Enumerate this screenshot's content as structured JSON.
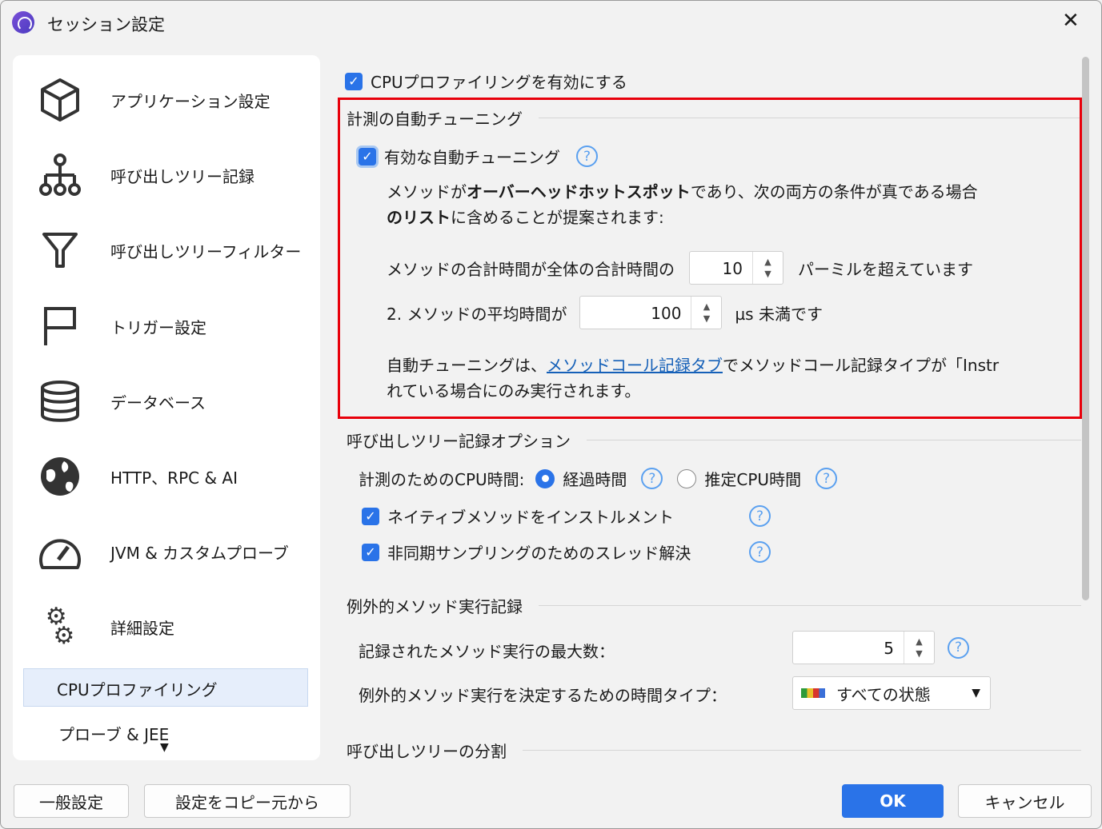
{
  "window": {
    "title": "セッション設定",
    "close": "✕"
  },
  "sidebar": {
    "items": [
      {
        "label": "アプリケーション設定",
        "icon": "cube-icon"
      },
      {
        "label": "呼び出しツリー記録",
        "icon": "tree-icon"
      },
      {
        "label": "呼び出しツリーフィルター",
        "icon": "filter-icon"
      },
      {
        "label": "トリガー設定",
        "icon": "flag-icon"
      },
      {
        "label": "データベース",
        "icon": "database-icon"
      },
      {
        "label": "HTTP、RPC & AI",
        "icon": "globe-icon"
      },
      {
        "label": "JVM & カスタムプローブ",
        "icon": "gauge-icon"
      },
      {
        "label": "詳細設定",
        "icon": "gears-icon"
      }
    ],
    "subitems": [
      "CPUプロファイリング",
      "プローブ & JEE"
    ]
  },
  "main": {
    "enable_cpu": "CPUプロファイリングを有効にする",
    "autotune_section": "計測の自動チューニング",
    "autotune_enable": "有効な自動チューニング",
    "desc1_a": "メソッドが",
    "desc1_b": "オーバーヘッドホットスポット",
    "desc1_c": "であり、次の両方の条件が真である場合",
    "desc2_a": "のリスト",
    "desc2_b": "に含めることが提案されます:",
    "cond1_label": "メソッドの合計時間が全体の合計時間の",
    "cond1_value": "10",
    "cond1_suffix": "パーミルを超えています",
    "cond2_label": "2. メソッドの平均時間が",
    "cond2_value": "100",
    "cond2_suffix": "µs 未満です",
    "note_a": "自動チューニングは、",
    "note_link": "メソッドコール記録タブ",
    "note_b": "でメソッドコール記録タイプが「Instr",
    "note2": "れている場合にのみ実行されます。",
    "calltree_section": "呼び出しツリー記録オプション",
    "cpu_time_label": "計測のためのCPU時間:",
    "radio_elapsed": "経過時間",
    "radio_cpu": "推定CPU時間",
    "native_label": "ネイティブメソッドをインストルメント",
    "async_label": "非同期サンプリングのためのスレッド解決",
    "exceptional_section": "例外的メソッド実行記録",
    "max_label": "記録されたメソッド実行の最大数：",
    "max_value": "5",
    "timetype_label": "例外的メソッド実行を決定するための時間タイプ：",
    "timetype_value": "すべての状態",
    "split_section": "呼び出しツリーの分割"
  },
  "footer": {
    "general": "一般設定",
    "copy": "設定をコピー元から",
    "ok": "OK",
    "cancel": "キャンセル"
  },
  "colors": {
    "accent": "#2a73e8",
    "highlight": "#e8000b"
  }
}
